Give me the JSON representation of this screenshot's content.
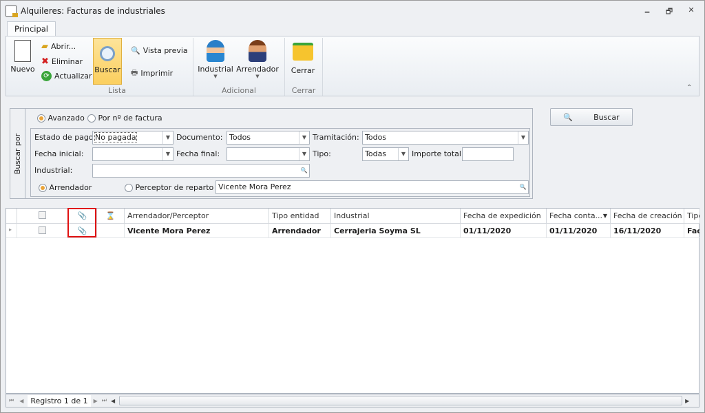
{
  "window": {
    "title": "Alquileres: Facturas de industriales",
    "minimize": "🗕",
    "restore": "🗗",
    "close": "✕"
  },
  "ribbon": {
    "tab": "Principal",
    "nuevo": "Nuevo",
    "abrir": "Abrir...",
    "eliminar": "Eliminar",
    "actualizar": "Actualizar",
    "buscar": "Buscar",
    "vista_previa": "Vista previa",
    "imprimir": "Imprimir",
    "industrial": "Industrial",
    "arrendador": "Arrendador",
    "cerrar": "Cerrar",
    "groups": {
      "lista": "Lista",
      "adicional": "Adicional",
      "cerrar": "Cerrar"
    },
    "collapse": "⌃"
  },
  "search": {
    "side_label": "Buscar por",
    "mode_avanzado": "Avanzado",
    "mode_factura": "Por nº de factura",
    "estado_pago_label": "Estado de pago:",
    "estado_pago": "No pagada",
    "documento_label": "Documento:",
    "documento": "Todos",
    "tramitacion_label": "Tramitación:",
    "tramitacion": "Todos",
    "fecha_inicial_label": "Fecha inicial:",
    "fecha_inicial": "",
    "fecha_final_label": "Fecha final:",
    "fecha_final": "",
    "tipo_label": "Tipo:",
    "tipo": "Todas",
    "importe_label": "Importe total:",
    "importe": "",
    "industrial_label": "Industrial:",
    "industrial": "",
    "arrendador_radio": "Arrendador",
    "perceptor_radio": "Perceptor de reparto",
    "persona": "Vicente Mora Perez",
    "buscar_button": "Buscar"
  },
  "grid": {
    "columns": [
      "Arrendador/Perceptor",
      "Tipo entidad",
      "Industrial",
      "Fecha de expedición",
      "Fecha conta...",
      "Fecha de creación",
      "Tipo"
    ],
    "rows": [
      {
        "arrendador": "Vicente Mora Perez",
        "tipo_entidad": "Arrendador",
        "industrial": "Cerrajeria Soyma SL",
        "fecha_expedicion": "01/11/2020",
        "fecha_contable": "01/11/2020",
        "fecha_creacion": "16/11/2020",
        "tipo": "Fac"
      }
    ]
  },
  "footer": {
    "record": "Registro 1 de 1"
  }
}
